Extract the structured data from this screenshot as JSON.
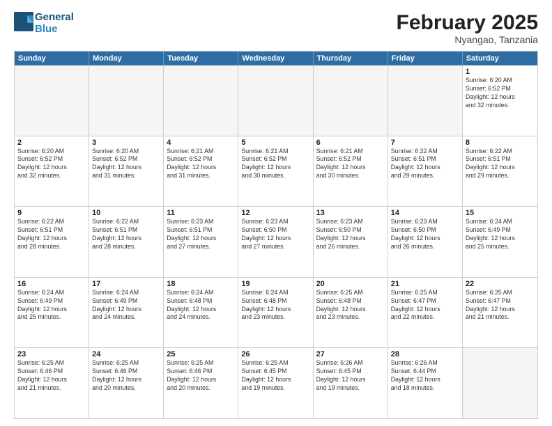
{
  "logo": {
    "line1": "General",
    "line2": "Blue"
  },
  "header": {
    "month": "February 2025",
    "location": "Nyangao, Tanzania"
  },
  "weekdays": [
    "Sunday",
    "Monday",
    "Tuesday",
    "Wednesday",
    "Thursday",
    "Friday",
    "Saturday"
  ],
  "weeks": [
    [
      {
        "day": "",
        "info": "",
        "empty": true
      },
      {
        "day": "",
        "info": "",
        "empty": true
      },
      {
        "day": "",
        "info": "",
        "empty": true
      },
      {
        "day": "",
        "info": "",
        "empty": true
      },
      {
        "day": "",
        "info": "",
        "empty": true
      },
      {
        "day": "",
        "info": "",
        "empty": true
      },
      {
        "day": "1",
        "info": "Sunrise: 6:20 AM\nSunset: 6:52 PM\nDaylight: 12 hours\nand 32 minutes.",
        "empty": false
      }
    ],
    [
      {
        "day": "2",
        "info": "Sunrise: 6:20 AM\nSunset: 6:52 PM\nDaylight: 12 hours\nand 32 minutes.",
        "empty": false
      },
      {
        "day": "3",
        "info": "Sunrise: 6:20 AM\nSunset: 6:52 PM\nDaylight: 12 hours\nand 31 minutes.",
        "empty": false
      },
      {
        "day": "4",
        "info": "Sunrise: 6:21 AM\nSunset: 6:52 PM\nDaylight: 12 hours\nand 31 minutes.",
        "empty": false
      },
      {
        "day": "5",
        "info": "Sunrise: 6:21 AM\nSunset: 6:52 PM\nDaylight: 12 hours\nand 30 minutes.",
        "empty": false
      },
      {
        "day": "6",
        "info": "Sunrise: 6:21 AM\nSunset: 6:52 PM\nDaylight: 12 hours\nand 30 minutes.",
        "empty": false
      },
      {
        "day": "7",
        "info": "Sunrise: 6:22 AM\nSunset: 6:51 PM\nDaylight: 12 hours\nand 29 minutes.",
        "empty": false
      },
      {
        "day": "8",
        "info": "Sunrise: 6:22 AM\nSunset: 6:51 PM\nDaylight: 12 hours\nand 29 minutes.",
        "empty": false
      }
    ],
    [
      {
        "day": "9",
        "info": "Sunrise: 6:22 AM\nSunset: 6:51 PM\nDaylight: 12 hours\nand 28 minutes.",
        "empty": false
      },
      {
        "day": "10",
        "info": "Sunrise: 6:22 AM\nSunset: 6:51 PM\nDaylight: 12 hours\nand 28 minutes.",
        "empty": false
      },
      {
        "day": "11",
        "info": "Sunrise: 6:23 AM\nSunset: 6:51 PM\nDaylight: 12 hours\nand 27 minutes.",
        "empty": false
      },
      {
        "day": "12",
        "info": "Sunrise: 6:23 AM\nSunset: 6:50 PM\nDaylight: 12 hours\nand 27 minutes.",
        "empty": false
      },
      {
        "day": "13",
        "info": "Sunrise: 6:23 AM\nSunset: 6:50 PM\nDaylight: 12 hours\nand 26 minutes.",
        "empty": false
      },
      {
        "day": "14",
        "info": "Sunrise: 6:23 AM\nSunset: 6:50 PM\nDaylight: 12 hours\nand 26 minutes.",
        "empty": false
      },
      {
        "day": "15",
        "info": "Sunrise: 6:24 AM\nSunset: 6:49 PM\nDaylight: 12 hours\nand 25 minutes.",
        "empty": false
      }
    ],
    [
      {
        "day": "16",
        "info": "Sunrise: 6:24 AM\nSunset: 6:49 PM\nDaylight: 12 hours\nand 25 minutes.",
        "empty": false
      },
      {
        "day": "17",
        "info": "Sunrise: 6:24 AM\nSunset: 6:49 PM\nDaylight: 12 hours\nand 24 minutes.",
        "empty": false
      },
      {
        "day": "18",
        "info": "Sunrise: 6:24 AM\nSunset: 6:48 PM\nDaylight: 12 hours\nand 24 minutes.",
        "empty": false
      },
      {
        "day": "19",
        "info": "Sunrise: 6:24 AM\nSunset: 6:48 PM\nDaylight: 12 hours\nand 23 minutes.",
        "empty": false
      },
      {
        "day": "20",
        "info": "Sunrise: 6:25 AM\nSunset: 6:48 PM\nDaylight: 12 hours\nand 23 minutes.",
        "empty": false
      },
      {
        "day": "21",
        "info": "Sunrise: 6:25 AM\nSunset: 6:47 PM\nDaylight: 12 hours\nand 22 minutes.",
        "empty": false
      },
      {
        "day": "22",
        "info": "Sunrise: 6:25 AM\nSunset: 6:47 PM\nDaylight: 12 hours\nand 21 minutes.",
        "empty": false
      }
    ],
    [
      {
        "day": "23",
        "info": "Sunrise: 6:25 AM\nSunset: 6:46 PM\nDaylight: 12 hours\nand 21 minutes.",
        "empty": false
      },
      {
        "day": "24",
        "info": "Sunrise: 6:25 AM\nSunset: 6:46 PM\nDaylight: 12 hours\nand 20 minutes.",
        "empty": false
      },
      {
        "day": "25",
        "info": "Sunrise: 6:25 AM\nSunset: 6:46 PM\nDaylight: 12 hours\nand 20 minutes.",
        "empty": false
      },
      {
        "day": "26",
        "info": "Sunrise: 6:25 AM\nSunset: 6:45 PM\nDaylight: 12 hours\nand 19 minutes.",
        "empty": false
      },
      {
        "day": "27",
        "info": "Sunrise: 6:26 AM\nSunset: 6:45 PM\nDaylight: 12 hours\nand 19 minutes.",
        "empty": false
      },
      {
        "day": "28",
        "info": "Sunrise: 6:26 AM\nSunset: 6:44 PM\nDaylight: 12 hours\nand 18 minutes.",
        "empty": false
      },
      {
        "day": "",
        "info": "",
        "empty": true
      }
    ]
  ]
}
